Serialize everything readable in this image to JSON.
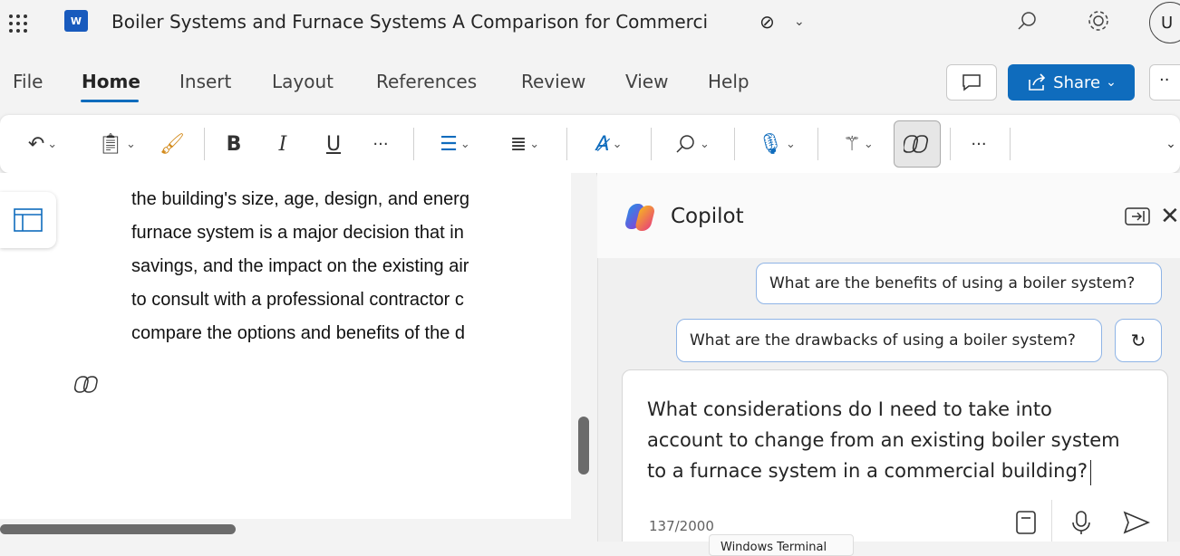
{
  "app": {
    "title": "Boiler Systems and Furnace Systems A Comparison for Commerci",
    "account_initial": "U"
  },
  "menu": {
    "items": [
      "File",
      "Home",
      "Insert",
      "Layout",
      "References",
      "Review",
      "View",
      "Help"
    ],
    "share_label": "Share"
  },
  "toolbar": {
    "bold": "B",
    "italic": "I",
    "underline": "U",
    "more": "···"
  },
  "document": {
    "lines": [
      "the building's size, age, design, and energ",
      "furnace system is a major decision that in",
      "savings, and the impact on the existing air",
      "to consult with a professional contractor c",
      "compare the options and benefits of the d"
    ]
  },
  "copilot": {
    "title": "Copilot",
    "suggestions": [
      "What are the benefits of using a boiler system?",
      "What are the drawbacks of using a boiler system?"
    ],
    "input_lines": [
      "What considerations do I need to take into",
      "account to change from an existing boiler system",
      "to a furnace system in a commercial building?"
    ],
    "char_count": "137/2000"
  },
  "tooltip": "Windows Terminal",
  "colors": {
    "accent": "#0f6cbd",
    "share_bg": "#0f6cbd",
    "word_blue": "#185abd"
  }
}
